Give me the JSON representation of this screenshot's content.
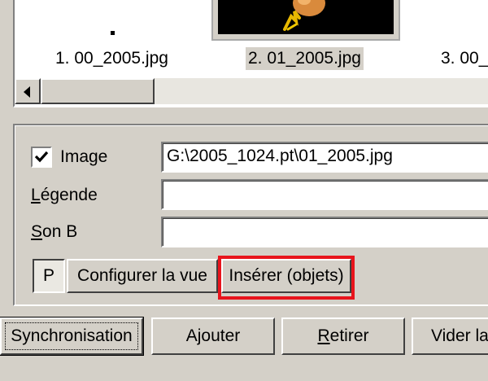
{
  "thumbnails": [
    {
      "caption": "1. 00_2005.jpg"
    },
    {
      "caption": "2. 01_2005.jpg",
      "selected": true
    },
    {
      "caption": "3. 00_"
    }
  ],
  "scrollbar_left_icon": "arrow-left-icon",
  "properties": {
    "image_label": "Image",
    "image_checked": true,
    "image_path": "G:\\2005_1024.pt\\01_2005.jpg",
    "legend_label": "Légende",
    "legend_value": "",
    "sound_label": "Son B",
    "sound_value": ""
  },
  "toolbar": {
    "p_label": "P",
    "configure_label": "Configurer la vue",
    "insert_label": "Insérer (objets)"
  },
  "buttons": {
    "sync_label": "Synchronisation",
    "add_label": "Ajouter",
    "remove_label": "Retirer",
    "clear_label": "Vider la"
  },
  "colors": {
    "highlight": "#e8141c",
    "window_bg": "#d4d0c8"
  }
}
